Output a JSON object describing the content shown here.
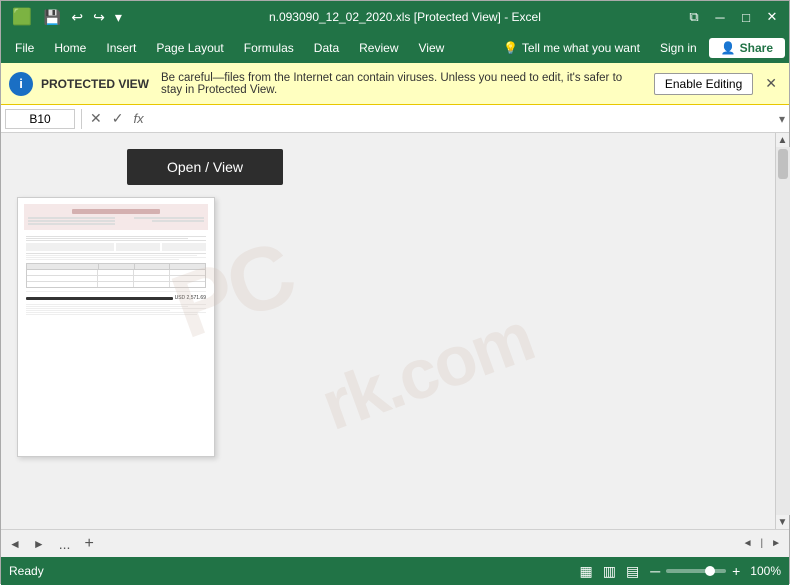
{
  "titleBar": {
    "saveIcon": "💾",
    "undoIcon": "↩",
    "redoIcon": "↪",
    "dropdownIcon": "▾",
    "title": "n.093090_12_02_2020.xls [Protected View] - Excel",
    "restoreIcon": "⧉",
    "minimizeIcon": "─",
    "maximizeIcon": "□",
    "closeIcon": "✕"
  },
  "menuBar": {
    "items": [
      "File",
      "Home",
      "Insert",
      "Page Layout",
      "Formulas",
      "Data",
      "Review",
      "View"
    ],
    "tellMe": {
      "icon": "💡",
      "text": "Tell me what you want",
      "signIn": "Sign in"
    },
    "shareLabel": "Share",
    "shareIcon": "👤"
  },
  "protectedBar": {
    "label": "PROTECTED VIEW",
    "message": "Be careful—files from the Internet can contain viruses. Unless you need to edit, it's safer to stay in Protected View.",
    "enableLabel": "Enable Editing",
    "closeIcon": "✕"
  },
  "formulaBar": {
    "cellRef": "B10",
    "cancelIcon": "✕",
    "confirmIcon": "✓",
    "functionIcon": "fx",
    "expandIcon": "▾"
  },
  "mainArea": {
    "openViewLabel": "Open / View",
    "watermark": "PC\nrk.com"
  },
  "sheetBar": {
    "dotTab": "...",
    "addIcon": "+",
    "scrollLeft": "◄",
    "scrollRight": "►"
  },
  "statusBar": {
    "readyLabel": "Ready",
    "viewIcons": [
      "▦",
      "▥",
      "▤"
    ],
    "zoomMinus": "─",
    "zoomPlus": "+",
    "zoomPercent": "100%"
  }
}
